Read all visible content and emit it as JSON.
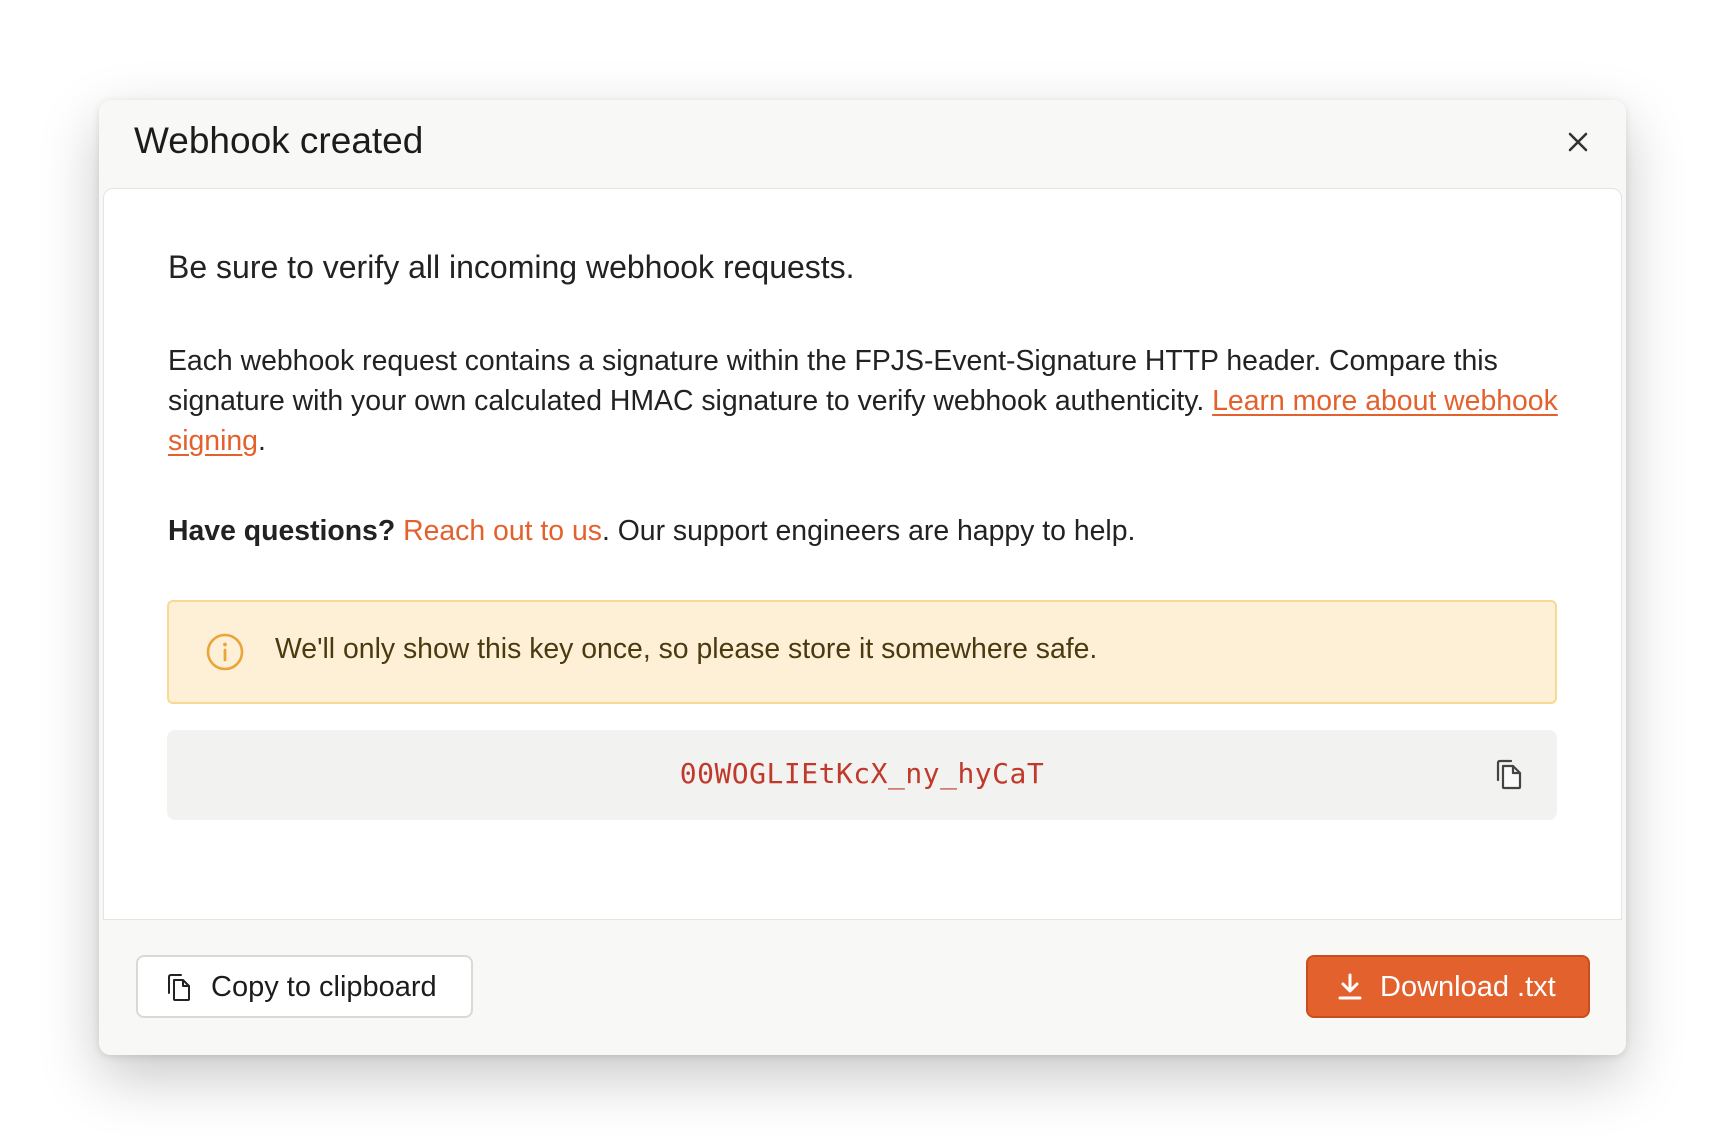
{
  "modal": {
    "title": "Webhook created",
    "lead": "Be sure to verify all incoming webhook requests.",
    "description": "Each webhook request contains a signature within the FPJS-Event-Signature HTTP header. Compare this signature with your own calculated HMAC signature to verify webhook authenticity. ",
    "learn_more_link": "Learn more about webhook signing",
    "description_end": ".",
    "questions_bold": "Have questions?",
    "reach_out_link": "Reach out to us",
    "questions_rest": ". Our support engineers are happy to help.",
    "alert_text": "We'll only show this key once, so please store it somewhere safe.",
    "secret_key": "00WOGLIEtKcX_ny_hyCaT"
  },
  "footer": {
    "copy_label": "Copy to clipboard",
    "download_label": "Download .txt"
  },
  "colors": {
    "accent": "#e3612d",
    "alert_bg": "#fdf0d6",
    "alert_border": "#f7d995",
    "alert_icon": "#eba43a",
    "key_text": "#c0392b"
  },
  "icons": {
    "close": "close-icon",
    "alert": "info-circle-icon",
    "key_copy": "copy-icon",
    "copy_button": "copy-icon",
    "download_button": "download-icon"
  }
}
